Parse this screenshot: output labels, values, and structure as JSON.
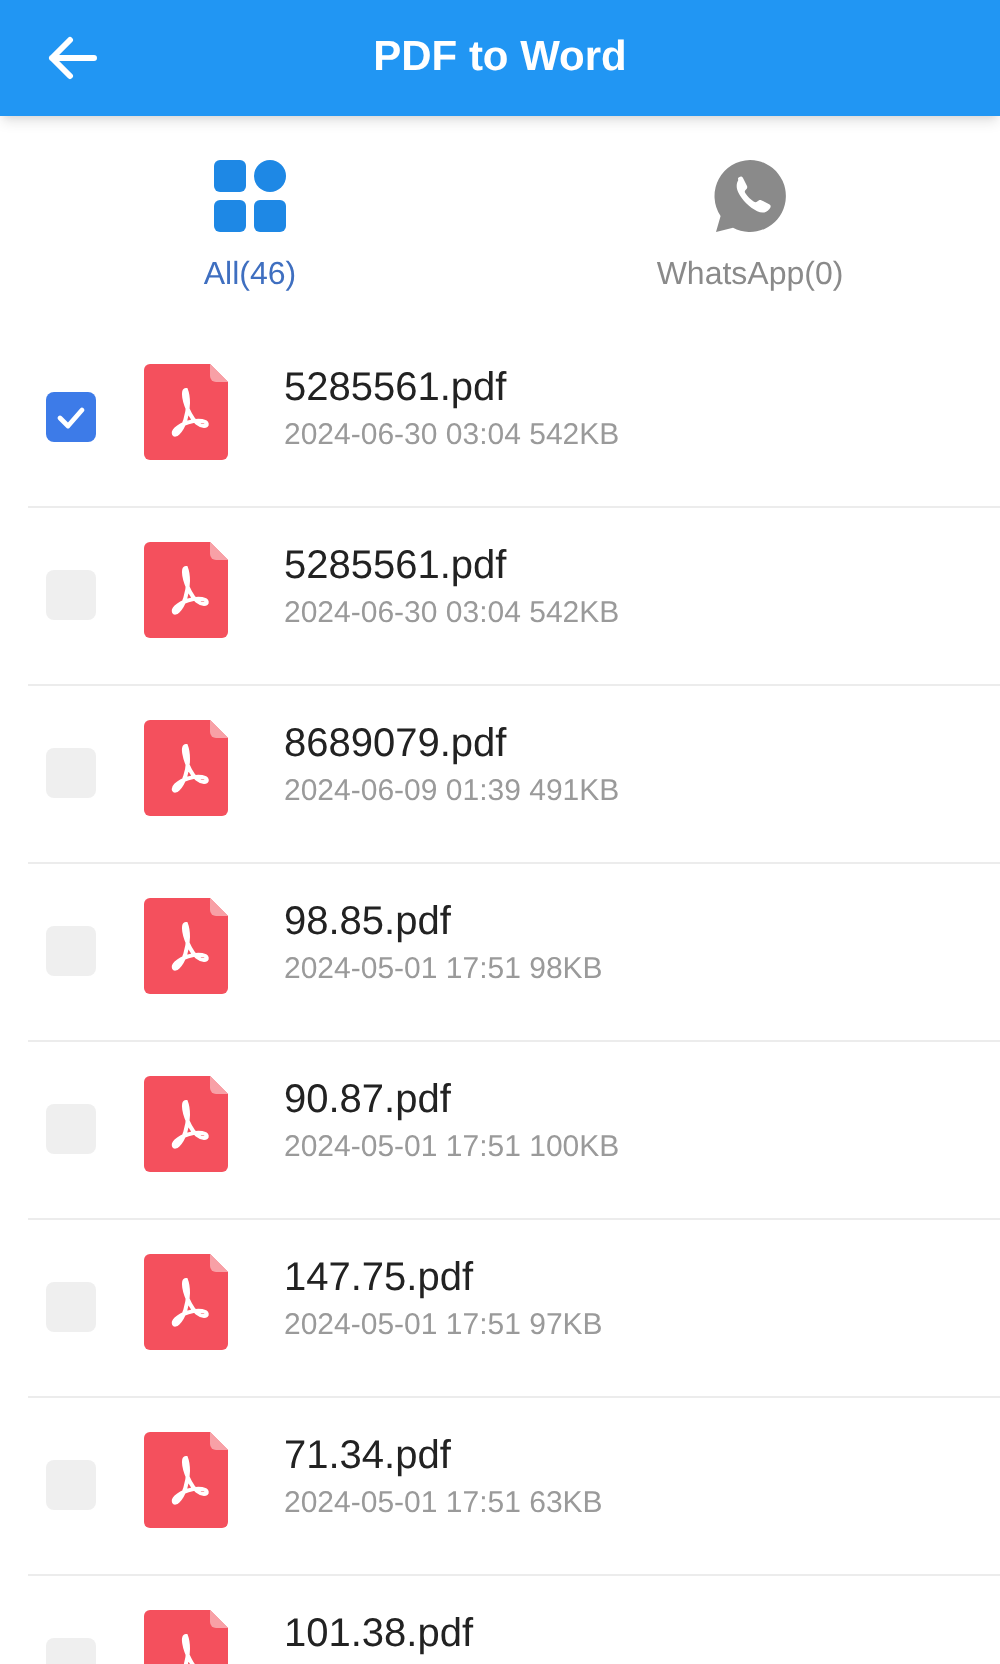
{
  "app_bar": {
    "title": "PDF to Word"
  },
  "tabs": [
    {
      "label": "All(46)",
      "kind": "all",
      "selected": true
    },
    {
      "label": "WhatsApp(0)",
      "kind": "whatsapp",
      "selected": false
    }
  ],
  "files": [
    {
      "name": "5285561.pdf",
      "meta": "2024-06-30 03:04 542KB",
      "checked": true
    },
    {
      "name": "5285561.pdf",
      "meta": "2024-06-30 03:04 542KB",
      "checked": false
    },
    {
      "name": "8689079.pdf",
      "meta": "2024-06-09 01:39 491KB",
      "checked": false
    },
    {
      "name": "98.85.pdf",
      "meta": "2024-05-01 17:51 98KB",
      "checked": false
    },
    {
      "name": "90.87.pdf",
      "meta": "2024-05-01 17:51 100KB",
      "checked": false
    },
    {
      "name": "147.75.pdf",
      "meta": "2024-05-01 17:51 97KB",
      "checked": false
    },
    {
      "name": "71.34.pdf",
      "meta": "2024-05-01 17:51 63KB",
      "checked": false
    },
    {
      "name": "101.38.pdf",
      "checked": false
    }
  ]
}
